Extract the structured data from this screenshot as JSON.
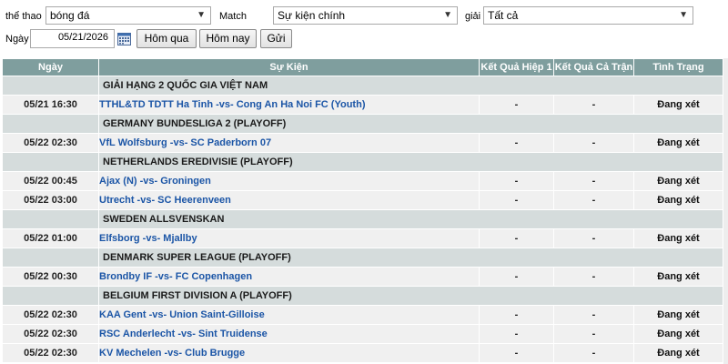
{
  "filters": {
    "sport_label": "thể thao",
    "sport_value": "bóng đá",
    "match_label": "Match",
    "match_value": "Sự kiện chính",
    "league_label": "giải",
    "league_value": "Tất cả",
    "date_label": "Ngày",
    "date_value": "05/21/2026",
    "yesterday_button": "Hôm qua",
    "today_button": "Hôm nay",
    "submit_button": "Gửi"
  },
  "table": {
    "headers": [
      "Ngày",
      "Sự Kiện",
      "Kết Quả Hiệp 1",
      "Kết Quả Cả Trận",
      "Tình Trạng"
    ],
    "rows": [
      {
        "type": "league",
        "name": "GIẢI HẠNG 2 QUỐC GIA VIỆT NAM"
      },
      {
        "type": "match",
        "date": "05/21 16:30",
        "event": "TTHL&TD TDTT Ha Tinh -vs- Cong An Ha Noi FC (Youth)",
        "ht": "-",
        "ft": "-",
        "status": "Đang xét"
      },
      {
        "type": "league",
        "name": "GERMANY BUNDESLIGA 2 (PLAYOFF)"
      },
      {
        "type": "match",
        "date": "05/22 02:30",
        "event": "VfL Wolfsburg -vs- SC Paderborn 07",
        "ht": "-",
        "ft": "-",
        "status": "Đang xét"
      },
      {
        "type": "league",
        "name": "NETHERLANDS EREDIVISIE (PLAYOFF)"
      },
      {
        "type": "match",
        "date": "05/22 00:45",
        "event": "Ajax (N) -vs- Groningen",
        "ht": "-",
        "ft": "-",
        "status": "Đang xét"
      },
      {
        "type": "match",
        "date": "05/22 03:00",
        "event": "Utrecht -vs- SC Heerenveen",
        "ht": "-",
        "ft": "-",
        "status": "Đang xét"
      },
      {
        "type": "league",
        "name": "SWEDEN ALLSVENSKAN"
      },
      {
        "type": "match",
        "date": "05/22 01:00",
        "event": "Elfsborg -vs- Mjallby",
        "ht": "-",
        "ft": "-",
        "status": "Đang xét"
      },
      {
        "type": "league",
        "name": "DENMARK SUPER LEAGUE (PLAYOFF)"
      },
      {
        "type": "match",
        "date": "05/22 00:30",
        "event": "Brondby IF -vs- FC Copenhagen",
        "ht": "-",
        "ft": "-",
        "status": "Đang xét"
      },
      {
        "type": "league",
        "name": "BELGIUM FIRST DIVISION A (PLAYOFF)"
      },
      {
        "type": "match",
        "date": "05/22 02:30",
        "event": "KAA Gent -vs- Union Saint-Gilloise",
        "ht": "-",
        "ft": "-",
        "status": "Đang xét"
      },
      {
        "type": "match",
        "date": "05/22 02:30",
        "event": "RSC Anderlecht -vs- Sint Truidense",
        "ht": "-",
        "ft": "-",
        "status": "Đang xét"
      },
      {
        "type": "match",
        "date": "05/22 02:30",
        "event": "KV Mechelen -vs- Club Brugge",
        "ht": "-",
        "ft": "-",
        "status": "Đang xét"
      }
    ]
  }
}
